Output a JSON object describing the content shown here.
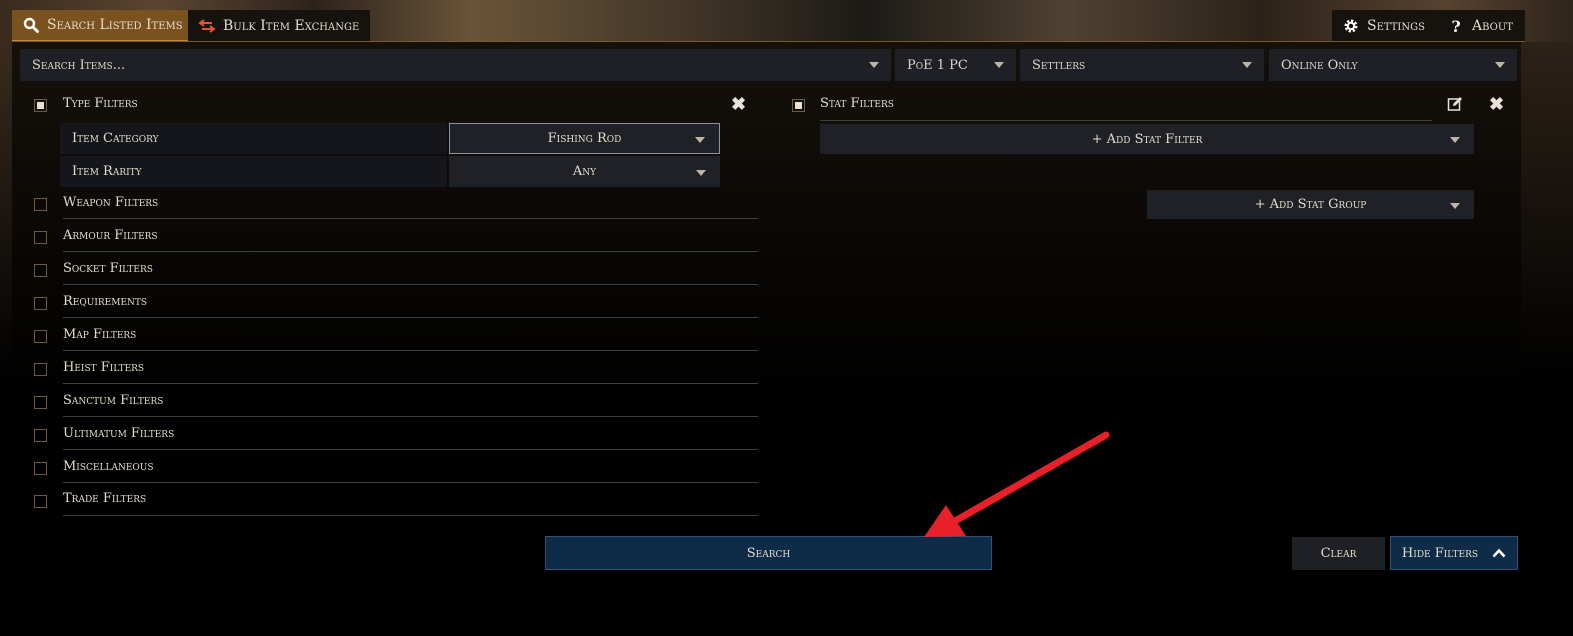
{
  "tabs": {
    "search_listed": "Search Listed Items",
    "bulk_exchange": "Bulk Item Exchange",
    "settings": "Settings",
    "about": "About"
  },
  "search_bar": {
    "placeholder": "Search Items...",
    "platform": "PoE 1 PC",
    "league": "Settlers",
    "status": "Online Only"
  },
  "type_filters": {
    "title": "Type Filters",
    "checked": true,
    "rows": [
      {
        "label": "Item Category",
        "value": "Fishing Rod"
      },
      {
        "label": "Item Rarity",
        "value": "Any"
      }
    ]
  },
  "filter_groups": [
    "Weapon Filters",
    "Armour Filters",
    "Socket Filters",
    "Requirements",
    "Map Filters",
    "Heist Filters",
    "Sanctum Filters",
    "Ultimatum Filters",
    "Miscellaneous",
    "Trade Filters"
  ],
  "stat_filters": {
    "title": "Stat Filters",
    "checked": true,
    "add_stat_filter": "+ Add Stat Filter",
    "add_stat_group": "+ Add Stat Group"
  },
  "actions": {
    "search": "Search",
    "clear": "Clear",
    "hide_filters": "Hide Filters"
  },
  "colors": {
    "accent_tab": "#7a5220",
    "button_blue": "#0e2b47",
    "annotation_arrow": "#e8202a"
  },
  "icons": {
    "search_tab": "magnifier-icon",
    "bulk_tab": "exchange-arrows-icon",
    "settings": "gear-icon",
    "about": "question-mark-icon",
    "edit": "edit-icon",
    "remove": "close-icon",
    "hide_filters": "chevron-up-icon"
  }
}
